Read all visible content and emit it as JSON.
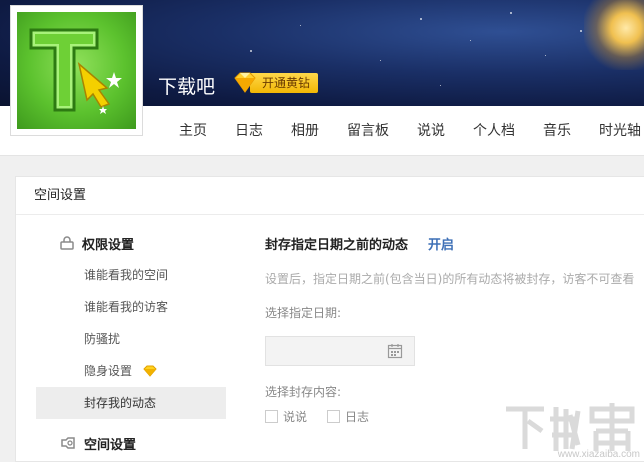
{
  "header": {
    "site_name": "下载吧",
    "vip_label": "开通黄钻"
  },
  "nav": {
    "items": [
      "主页",
      "日志",
      "相册",
      "留言板",
      "说说",
      "个人档",
      "音乐",
      "时光轴"
    ]
  },
  "card": {
    "title": "空间设置"
  },
  "sidebar": {
    "group_permissions": "权限设置",
    "links": [
      "谁能看我的空间",
      "谁能看我的访客",
      "防骚扰",
      "隐身设置",
      "封存我的动态"
    ],
    "active_index": 4,
    "group_space": "空间设置"
  },
  "content": {
    "title": "封存指定日期之前的动态",
    "enable": "开启",
    "description": "设置后，指定日期之前(包含当日)的所有动态将被封存，访客不可查看",
    "date_label": "选择指定日期:",
    "date_value": "",
    "content_label": "选择封存内容:",
    "options": [
      "说说",
      "日志"
    ]
  },
  "watermark": {
    "logo_text": "下载吧",
    "url": "www.xiazaiba.com"
  },
  "colors": {
    "link_blue": "#3d6fb6",
    "vip_gold": "#f2b705",
    "avatar_green": "#5cc22e"
  }
}
